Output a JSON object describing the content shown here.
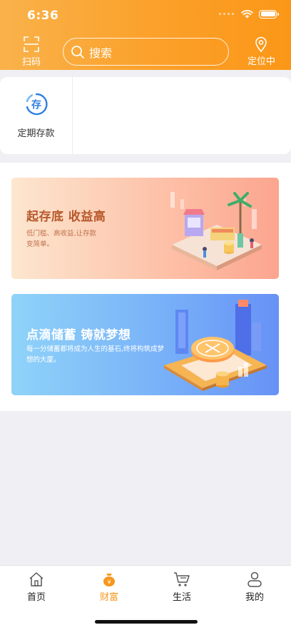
{
  "status_bar": {
    "time": "6:36"
  },
  "header": {
    "scan_label": "扫码",
    "search_placeholder": "搜索",
    "location_label": "定位中"
  },
  "services": [
    {
      "label": "定期存款",
      "icon": "deposit-icon",
      "icon_text": "存"
    }
  ],
  "banners": [
    {
      "title": "起存底 收益高",
      "desc": "低门槛、高收益,让存款变简单。"
    },
    {
      "title": "点滴储蓄 铸就梦想",
      "desc": "每一分储蓄都将成为人生的基石,终将构筑成梦想的大厦。"
    }
  ],
  "tabbar": {
    "items": [
      {
        "label": "首页",
        "icon": "home-icon",
        "active": false
      },
      {
        "label": "财富",
        "icon": "money-bag-icon",
        "active": true
      },
      {
        "label": "生活",
        "icon": "cart-icon",
        "active": false
      },
      {
        "label": "我的",
        "icon": "user-icon",
        "active": false
      }
    ]
  },
  "colors": {
    "header_start": "#f9b24a",
    "header_end": "#fb9717",
    "accent": "#f7971c",
    "icon_blue": "#2f7fe0"
  }
}
